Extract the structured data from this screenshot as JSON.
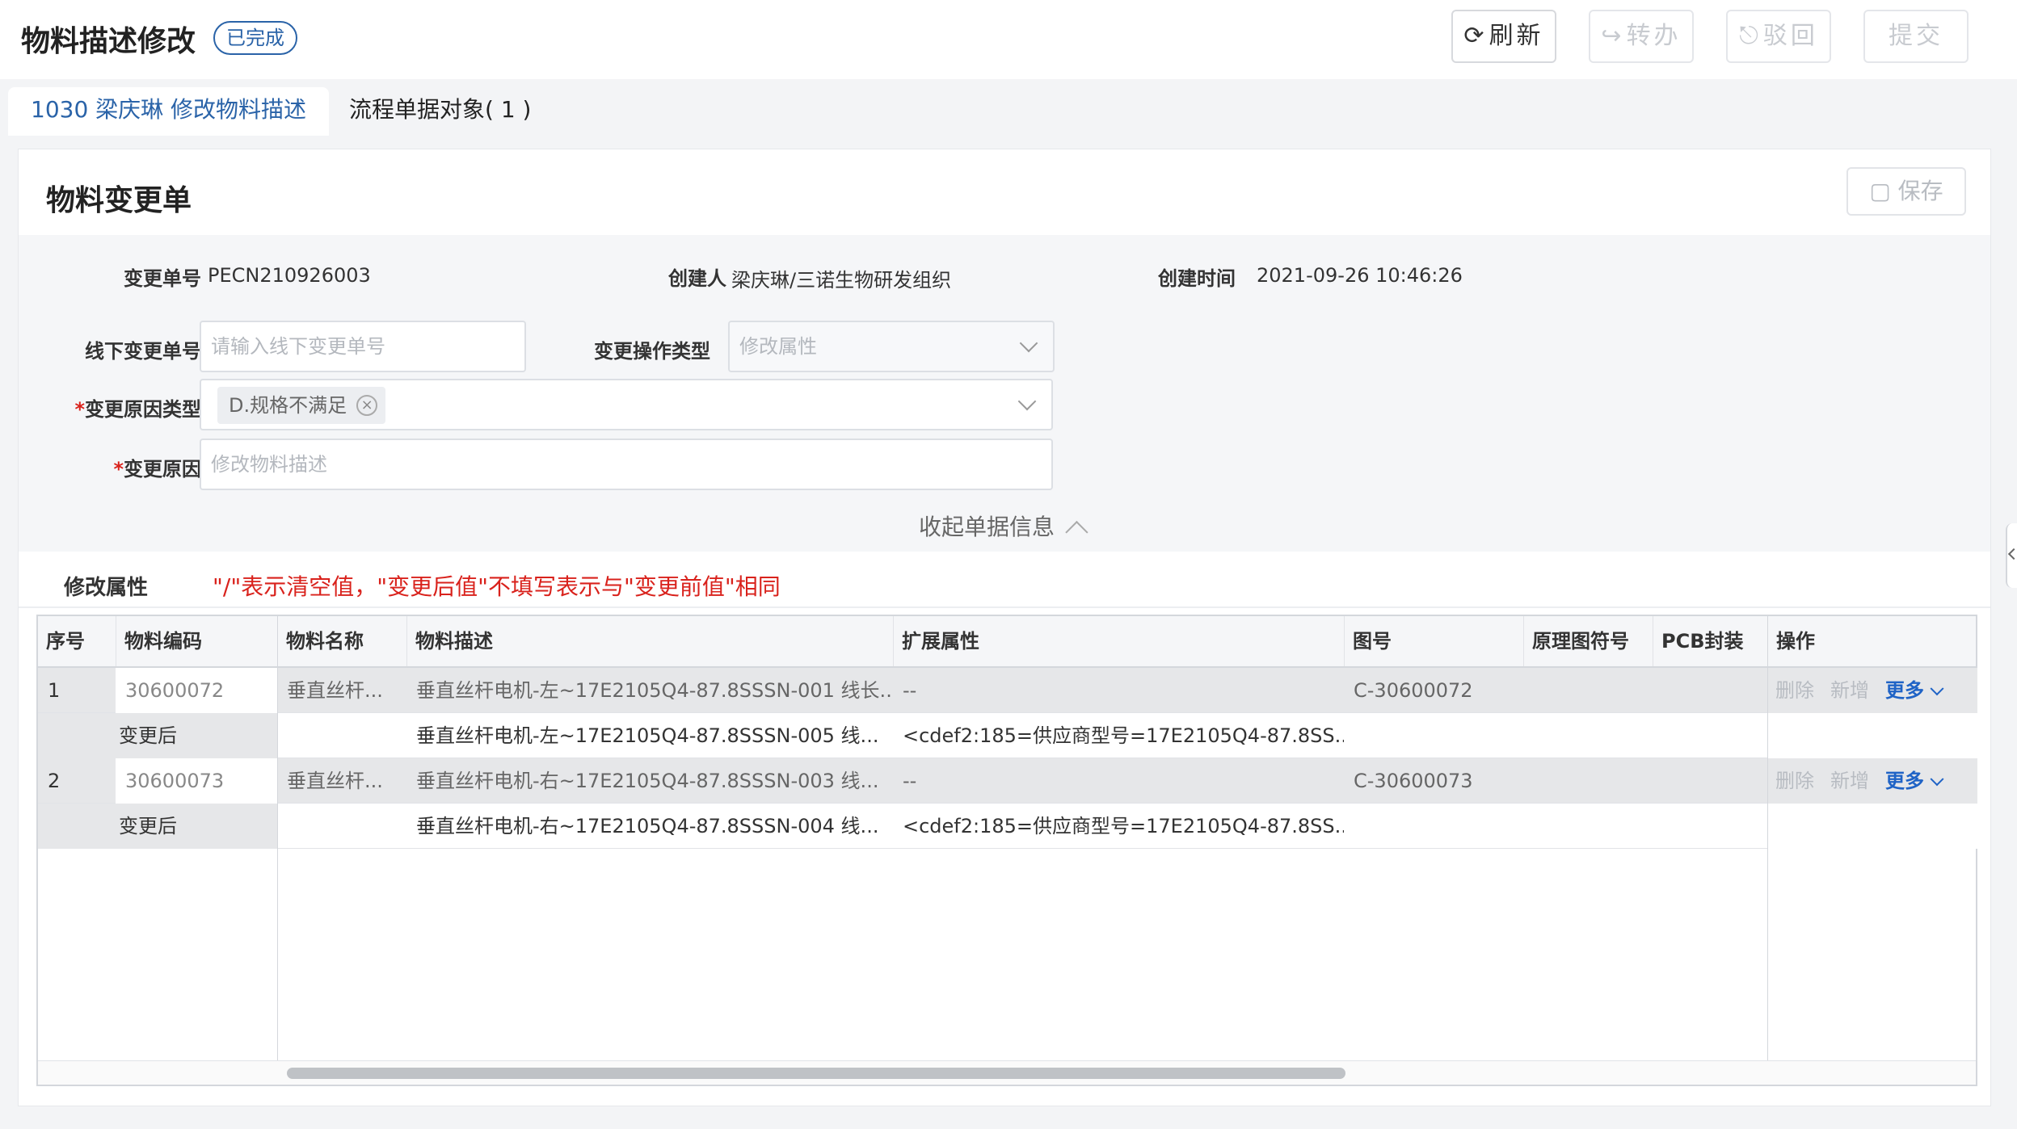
{
  "header": {
    "title": "物料描述修改",
    "status": "已完成",
    "buttons": {
      "refresh": "刷新",
      "transfer": "转办",
      "reject": "驳回",
      "submit": "提交"
    }
  },
  "tabs": [
    {
      "label": "1030 梁庆琳 修改物料描述",
      "active": true
    },
    {
      "label": "流程单据对象( 1 )",
      "active": false
    }
  ],
  "card": {
    "title": "物料变更单",
    "save_label": "保存"
  },
  "form": {
    "change_no_label": "变更单号",
    "change_no": "PECN210926003",
    "creator_label": "创建人",
    "creator": "梁庆琳/三诺生物研发组织",
    "created_time_label": "创建时间",
    "created_time": "2021-09-26 10:46:26",
    "offline_no_label": "线下变更单号",
    "offline_no_placeholder": "请输入线下变更单号",
    "op_type_label": "变更操作类型",
    "op_type_value": "修改属性",
    "reason_type_label": "变更原因类型",
    "reason_type_tag": "D.规格不满足",
    "reason_label": "变更原因",
    "reason_placeholder": "修改物料描述",
    "collapse_label": "收起单据信息"
  },
  "attr": {
    "label": "修改属性",
    "note": "\"/\"表示清空值，\"变更后值\"不填写表示与\"变更前值\"相同"
  },
  "table": {
    "columns": [
      "序号",
      "物料编码",
      "物料名称",
      "物料描述",
      "扩展属性",
      "图号",
      "原理图符号",
      "PCB封装",
      "操作"
    ],
    "after_label": "变更后",
    "ops": {
      "delete": "删除",
      "add": "新增",
      "more": "更多"
    },
    "rows": [
      {
        "index": "1",
        "code": "30600072",
        "name": "垂直丝杆...",
        "desc": "垂直丝杆电机-左~17E2105Q4-87.8SSSN-001 线长...",
        "ext": "--",
        "drawing": "C-30600072",
        "after_desc": "垂直丝杆电机-左~17E2105Q4-87.8SSSN-005 线...",
        "after_ext": "<cdef2:185=供应商型号=17E2105Q4-87.8SS..."
      },
      {
        "index": "2",
        "code": "30600073",
        "name": "垂直丝杆...",
        "desc": "垂直丝杆电机-右~17E2105Q4-87.8SSSN-003 线...",
        "ext": "--",
        "drawing": "C-30600073",
        "after_desc": "垂直丝杆电机-右~17E2105Q4-87.8SSSN-004 线...",
        "after_ext": "<cdef2:185=供应商型号=17E2105Q4-87.8SS..."
      }
    ]
  },
  "colors": {
    "accent": "#2a63a8",
    "required": "#d9221c",
    "link": "#1f63c6"
  }
}
